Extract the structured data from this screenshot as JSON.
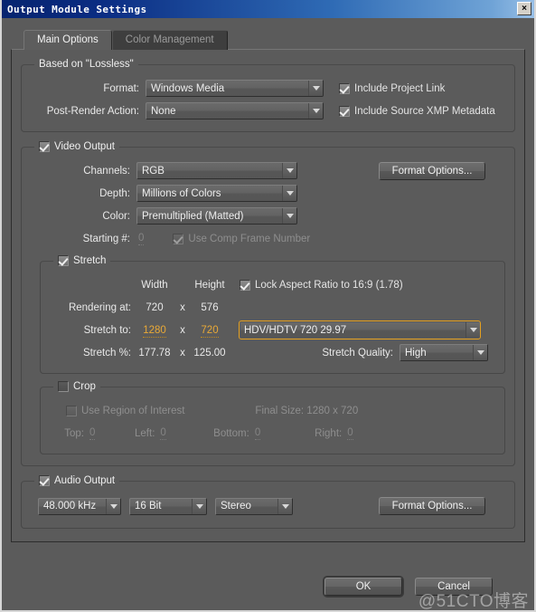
{
  "window": {
    "title": "Output Module Settings",
    "close_label": "×"
  },
  "tabs": [
    {
      "label": "Main Options",
      "active": true
    },
    {
      "label": "Color Management",
      "active": false
    }
  ],
  "based_on": {
    "legend": "Based on \"Lossless\"",
    "format_label": "Format:",
    "format_value": "Windows Media",
    "post_render_label": "Post-Render Action:",
    "post_render_value": "None",
    "include_project_link": "Include Project Link",
    "include_xmp": "Include Source XMP Metadata"
  },
  "video_output": {
    "legend": "Video Output",
    "channels_label": "Channels:",
    "channels_value": "RGB",
    "depth_label": "Depth:",
    "depth_value": "Millions of Colors",
    "color_label": "Color:",
    "color_value": "Premultiplied (Matted)",
    "starting_label": "Starting #:",
    "starting_value": "0",
    "use_comp_frame_number": "Use Comp Frame Number",
    "format_options": "Format Options..."
  },
  "stretch": {
    "legend": "Stretch",
    "col_width": "Width",
    "col_height": "Height",
    "lock_aspect": "Lock Aspect Ratio to 16:9 (1.78)",
    "rendering_at_label": "Rendering at:",
    "rendering_at_width": "720",
    "rendering_at_x": "x",
    "rendering_at_height": "576",
    "stretch_to_label": "Stretch to:",
    "stretch_to_width": "1280",
    "stretch_to_x": "x",
    "stretch_to_height": "720",
    "preset_value": "HDV/HDTV 720 29.97",
    "stretch_pct_label": "Stretch %:",
    "stretch_pct_width": "177.78",
    "stretch_pct_x": "x",
    "stretch_pct_height": "125.00",
    "quality_label": "Stretch Quality:",
    "quality_value": "High"
  },
  "crop": {
    "legend": "Crop",
    "use_region_of_interest": "Use Region of Interest",
    "final_size": "Final Size: 1280 x 720",
    "top_label": "Top:",
    "top_value": "0",
    "left_label": "Left:",
    "left_value": "0",
    "bottom_label": "Bottom:",
    "bottom_value": "0",
    "right_label": "Right:",
    "right_value": "0"
  },
  "audio_output": {
    "legend": "Audio Output",
    "sample_rate": "48.000 kHz",
    "bit_depth": "16 Bit",
    "channels": "Stereo",
    "format_options": "Format Options..."
  },
  "footer": {
    "ok": "OK",
    "cancel": "Cancel",
    "watermark": "@51CTO博客"
  },
  "colors": {
    "accent_orange": "#e9a937",
    "titlebar_blue": "#0a2c82",
    "panel_bg": "#5b5b5b"
  }
}
